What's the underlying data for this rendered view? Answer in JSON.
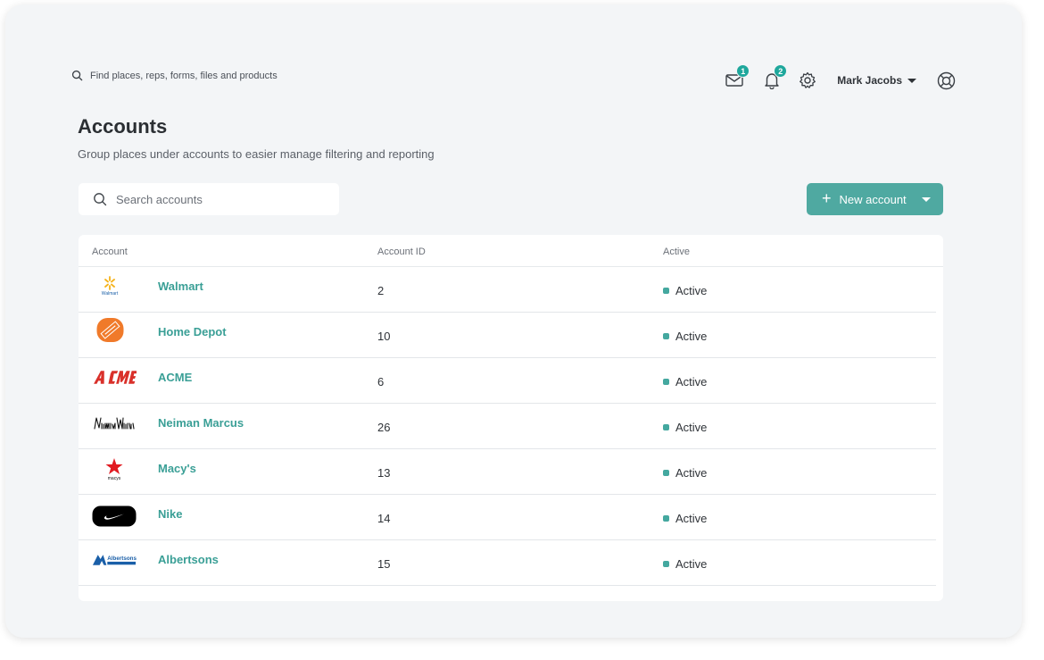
{
  "topbar": {
    "search_placeholder": "Find places, reps, forms, files and products",
    "messages_count": "1",
    "notifications_count": "2",
    "user_name": "Mark Jacobs"
  },
  "page": {
    "title": "Accounts",
    "subtitle": "Group places under accounts to easier manage filtering and reporting"
  },
  "search": {
    "placeholder": "Search accounts"
  },
  "new_button": {
    "label": "New account"
  },
  "table": {
    "headers": {
      "account": "Account",
      "account_id": "Account ID",
      "active": "Active"
    },
    "rows": [
      {
        "name": "Walmart",
        "id": "2",
        "status": "Active",
        "logo": "walmart-logo"
      },
      {
        "name": "Home Depot",
        "id": "10",
        "status": "Active",
        "logo": "home-depot-logo"
      },
      {
        "name": "ACME",
        "id": "6",
        "status": "Active",
        "logo": "acme-logo"
      },
      {
        "name": "Neiman Marcus",
        "id": "26",
        "status": "Active",
        "logo": "neiman-marcus-logo"
      },
      {
        "name": "Macy's",
        "id": "13",
        "status": "Active",
        "logo": "macys-logo"
      },
      {
        "name": "Nike",
        "id": "14",
        "status": "Active",
        "logo": "nike-logo"
      },
      {
        "name": "Albertsons",
        "id": "15",
        "status": "Active",
        "logo": "albertsons-logo"
      }
    ]
  },
  "colors": {
    "accent": "#4fa9a1",
    "link": "#3a9f96",
    "background": "#f3f5f7"
  }
}
